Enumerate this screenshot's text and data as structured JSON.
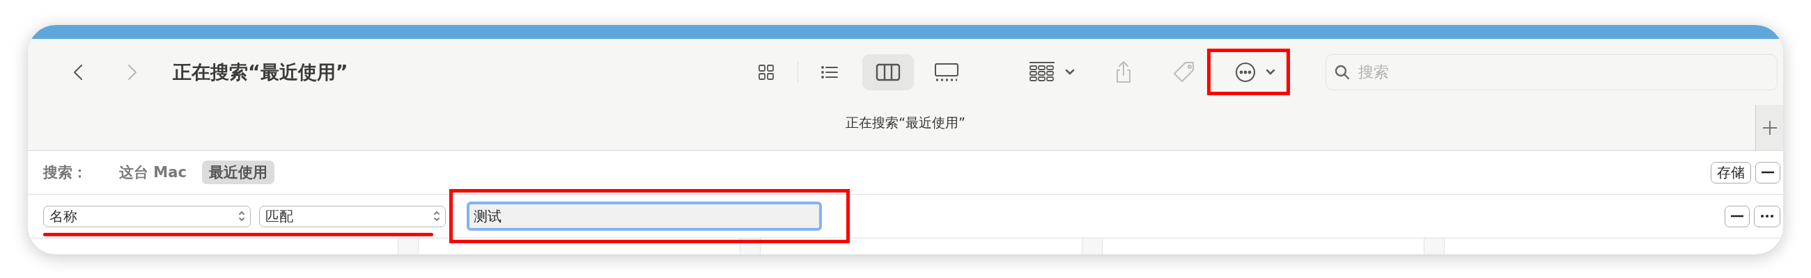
{
  "toolbar": {
    "nav": [
      {
        "kind": "back",
        "disabled": false
      },
      {
        "kind": "forward",
        "disabled": true
      }
    ],
    "title": "正在搜索“最近使用”",
    "view_modes": [
      {
        "kind": "icons",
        "selected": false
      },
      {
        "kind": "list",
        "selected": false
      },
      {
        "kind": "columns",
        "selected": true
      },
      {
        "kind": "gallery",
        "selected": false
      }
    ],
    "actions": [
      {
        "kind": "group",
        "disabled": false
      },
      {
        "kind": "share",
        "disabled": true
      },
      {
        "kind": "tag",
        "disabled": true
      },
      {
        "kind": "more",
        "disabled": false
      }
    ],
    "search": {
      "placeholder": "搜索"
    }
  },
  "tab_bar": {
    "tabs": [
      {
        "label": "正在搜索“最近使用”",
        "selected": true
      }
    ]
  },
  "scope_bar": {
    "label": "搜索：",
    "scopes": [
      {
        "label": "这台 Mac",
        "selected": false
      },
      {
        "label": "最近使用",
        "selected": true
      }
    ],
    "save_button": "存储"
  },
  "criteria": [
    {
      "attribute": "名称",
      "operator": "匹配",
      "value": "测试",
      "focused": true
    }
  ]
}
